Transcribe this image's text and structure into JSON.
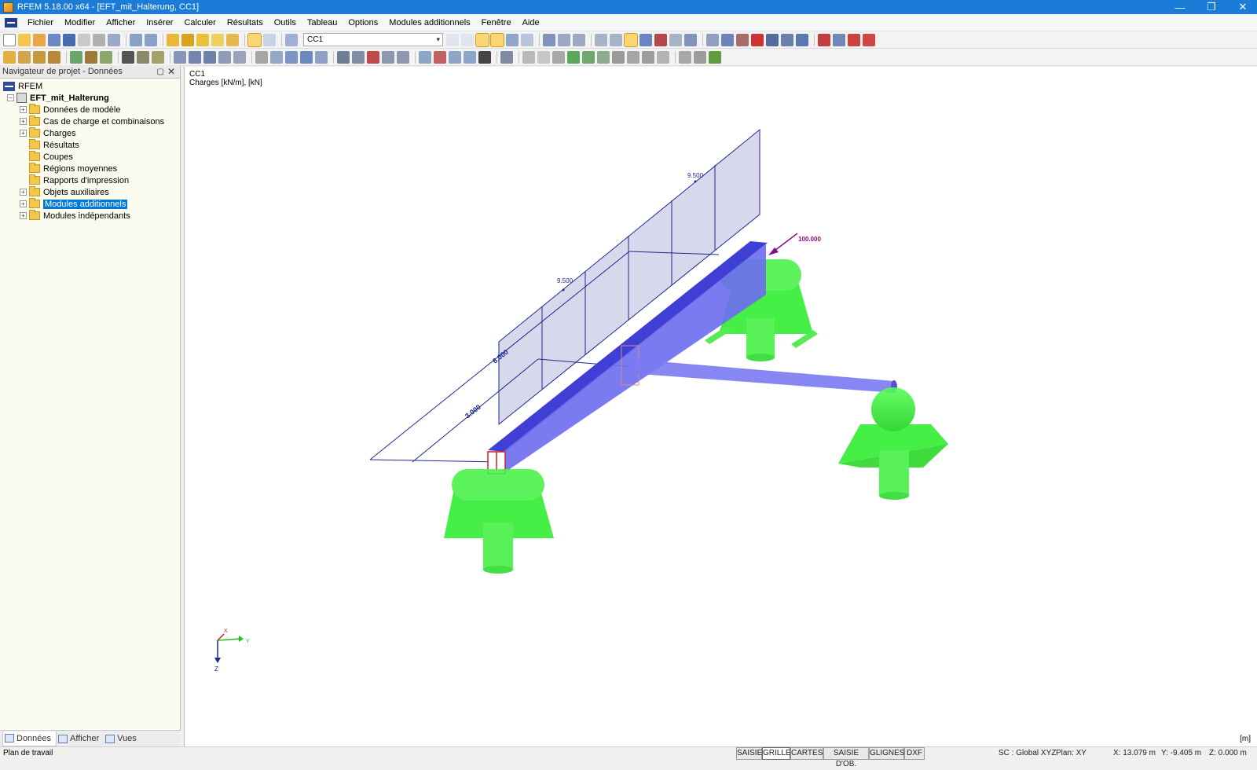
{
  "window": {
    "title": "RFEM 5.18.00 x64 - [EFT_mit_Halterung, CC1]"
  },
  "menu": [
    "Fichier",
    "Modifier",
    "Afficher",
    "Insérer",
    "Calculer",
    "Résultats",
    "Outils",
    "Tableau",
    "Options",
    "Modules additionnels",
    "Fenêtre",
    "Aide"
  ],
  "toolbar": {
    "load_case": "CC1"
  },
  "navigator": {
    "title": "Navigateur de projet - Données",
    "root": "RFEM",
    "model": "EFT_mit_Halterung",
    "items": [
      {
        "label": "Données de modèle",
        "expandable": true
      },
      {
        "label": "Cas de charge et combinaisons",
        "expandable": true
      },
      {
        "label": "Charges",
        "expandable": true
      },
      {
        "label": "Résultats",
        "expandable": false
      },
      {
        "label": "Coupes",
        "expandable": false
      },
      {
        "label": "Régions moyennes",
        "expandable": false
      },
      {
        "label": "Rapports d'impression",
        "expandable": false
      },
      {
        "label": "Objets auxiliaires",
        "expandable": true
      },
      {
        "label": "Modules additionnels",
        "expandable": true,
        "selected": true
      },
      {
        "label": "Modules indépendants",
        "expandable": true
      }
    ],
    "tabs": [
      "Données",
      "Afficher",
      "Vues"
    ]
  },
  "viewport": {
    "case": "CC1",
    "subtitle": "Charges [kN/m], [kN]",
    "unit": "[m]",
    "labels": {
      "load_top": "9.500",
      "load_mid": "9.500",
      "point_load": "100.000",
      "dim_total": "6.000",
      "dim_half": "3.000"
    },
    "axes": {
      "x": "X",
      "y": "Y",
      "z": "Z"
    },
    "colors": {
      "member": "#6b6bf0",
      "support": "#22ee22",
      "load": "#1c2a8f",
      "point_load": "#8b0a8b"
    }
  },
  "status": {
    "left": "Plan de travail",
    "buttons": [
      "SAISIE",
      "GRILLE",
      "CARTES",
      "SAISIE D'OB.",
      "GLIGNES",
      "DXF"
    ],
    "active_button": "GRILLE",
    "cs": "SC : Global XYZ",
    "plane": "Plan: XY",
    "x": "X: 13.079 m",
    "y": "Y: -9.405 m",
    "z": "Z: 0.000 m"
  }
}
